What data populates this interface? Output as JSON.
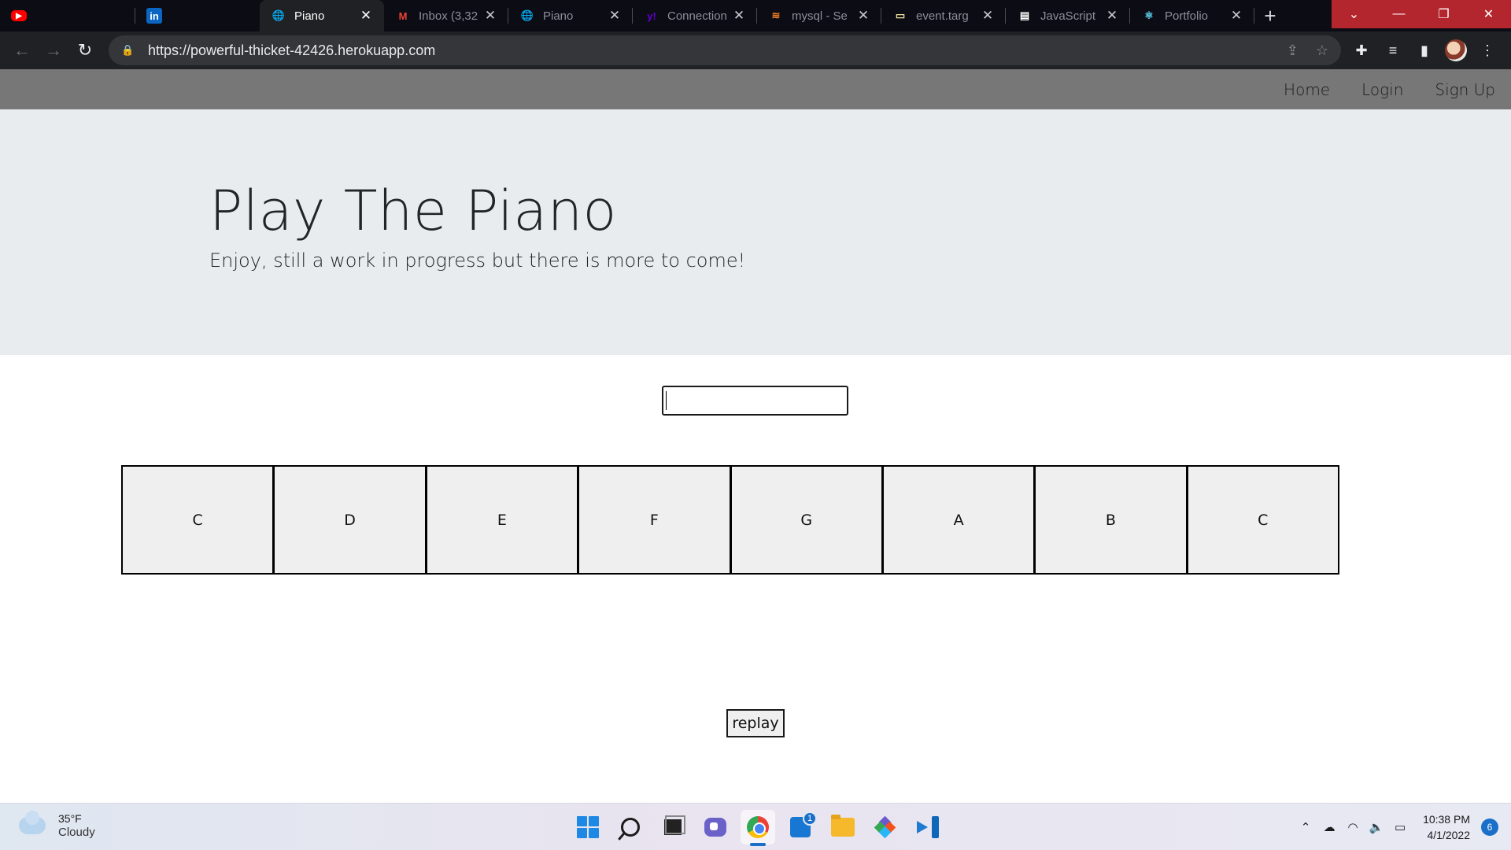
{
  "browser": {
    "tabs": [
      {
        "title": "",
        "icon": "youtube-icon",
        "color": "#ff0000",
        "glyph": "▶"
      },
      {
        "title": "",
        "icon": "linkedin-icon",
        "color": "#0a66c2",
        "glyph": "in"
      },
      {
        "title": "Piano",
        "icon": "globe-icon",
        "color": "#ffffff",
        "glyph": "🌐",
        "active": true
      },
      {
        "title": "Inbox (3,32",
        "icon": "gmail-icon",
        "color": "#ea4335",
        "glyph": "M"
      },
      {
        "title": "Piano",
        "icon": "globe-icon",
        "color": "#ffffff",
        "glyph": "🌐"
      },
      {
        "title": "Connection",
        "icon": "yahoo-icon",
        "color": "#6001d2",
        "glyph": "y!"
      },
      {
        "title": "mysql - Se",
        "icon": "stackoverflow-icon",
        "color": "#f48024",
        "glyph": "≋"
      },
      {
        "title": "event.targ",
        "icon": "laptop-icon",
        "color": "#f2e6a0",
        "glyph": "▭"
      },
      {
        "title": "JavaScript",
        "icon": "document-icon",
        "color": "#ffffff",
        "glyph": "▤"
      },
      {
        "title": "Portfolio",
        "icon": "react-icon",
        "color": "#61dafb",
        "glyph": "⚛"
      }
    ],
    "url": "https://powerful-thicket-42426.herokuapp.com",
    "window_controls": {
      "tab_search": "⌄",
      "minimize": "—",
      "restore": "❐",
      "close": "✕"
    }
  },
  "site": {
    "nav": {
      "home": "Home",
      "login": "Login",
      "signup": "Sign Up"
    },
    "title": "Play The Piano",
    "subtitle": "Enjoy, still a work in progress but there is more to come!",
    "note_input_value": "",
    "keys": [
      "C",
      "D",
      "E",
      "F",
      "G",
      "A",
      "B",
      "C"
    ],
    "replay_label": "replay"
  },
  "taskbar": {
    "weather_temp": "35°F",
    "weather_condition": "Cloudy",
    "store_badge": "1",
    "time": "10:38 PM",
    "date": "4/1/2022",
    "notification_count": "6"
  }
}
